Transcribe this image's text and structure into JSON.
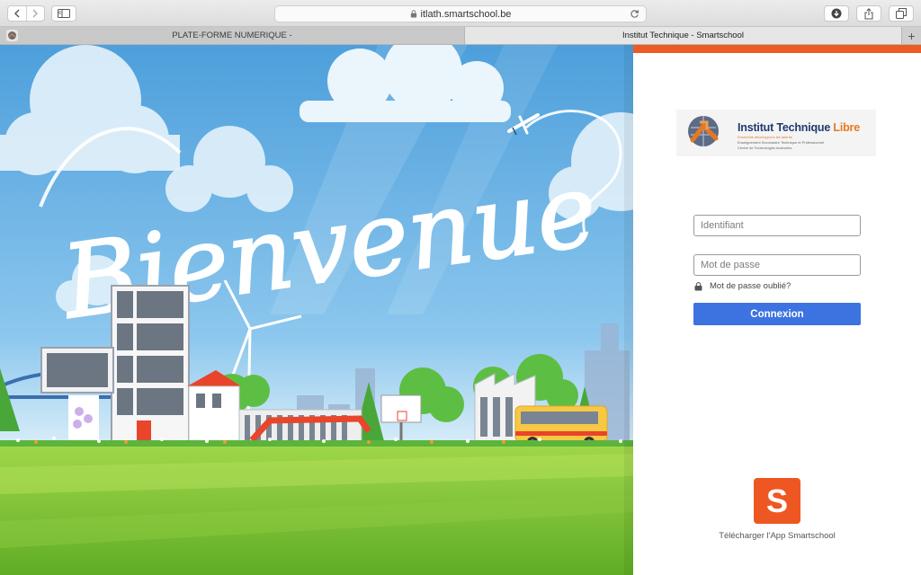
{
  "browser": {
    "url": "itlath.smartschool.be",
    "tabs": [
      {
        "label": "PLATE-FORME NUMERIQUE -"
      },
      {
        "label": "Institut Technique - Smartschool"
      }
    ],
    "new_tab_label": "+"
  },
  "scene": {
    "welcome_text": "Bienvenue"
  },
  "login": {
    "accent_color": "#ee5a24",
    "logo": {
      "name_main": "Institut Technique ",
      "name_accent": "Libre",
      "tagline": "Ensemble développons les talents",
      "line1": "Enseignement Secondaire Technique et Professionnel",
      "line2": "Centre de Technologies Avancées"
    },
    "username_placeholder": "Identifiant",
    "password_placeholder": "Mot de passe",
    "forgot_label": "Mot de passe oublié?",
    "submit_label": "Connexion",
    "submit_color": "#3d73e0",
    "app_icon_letter": "S",
    "app_label": "Télécharger l'App Smartschool"
  }
}
